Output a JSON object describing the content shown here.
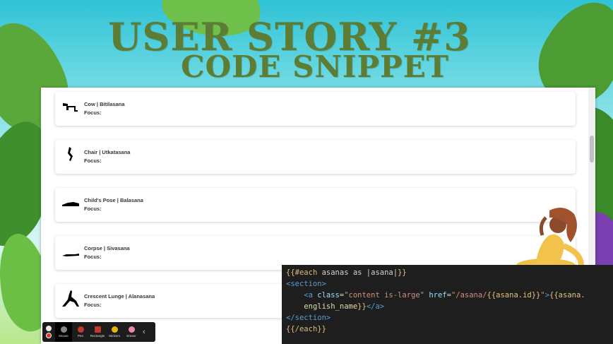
{
  "slide": {
    "title_line1": "USER STORY #3",
    "title_line2": "CODE SNIPPET"
  },
  "poses": [
    {
      "name": "Cow | Bitilasana",
      "focus": "Focus:",
      "icon": "cow-pose-icon"
    },
    {
      "name": "Chair | Utkatasana",
      "focus": "Focus:",
      "icon": "chair-pose-icon"
    },
    {
      "name": "Child's Pose | Balasana",
      "focus": "Focus:",
      "icon": "childs-pose-icon"
    },
    {
      "name": "Corpse | Sivasana",
      "focus": "Focus:",
      "icon": "corpse-pose-icon"
    },
    {
      "name": "Crescent Lunge | Alanasana",
      "focus": "Focus:",
      "icon": "crescent-lunge-icon"
    }
  ],
  "code": {
    "line1_open": "{{",
    "line1_kw": "#each",
    "line1_rest": " asanas as |asana|",
    "line1_close": "}}",
    "line2": "<section>",
    "line3_tag_open": "<a ",
    "line3_attr1": "class",
    "line3_eq1": "=",
    "line3_str1": "\"content is-large\"",
    "line3_attr2": " href",
    "line3_eq2": "=",
    "line3_str2": "\"/asana/",
    "line3_hb": "{{asana.id}}",
    "line3_str3": "\"",
    "line3_tag_close": ">",
    "line3_hb2": "{{asana.",
    "line4_text": "english_name",
    "line4_hb": "}}",
    "line4_close": "</a>",
    "line5": "</section>",
    "line6_open": "{{",
    "line6_kw": "/each",
    "line6_close": "}}"
  },
  "toolbar": {
    "items": [
      {
        "label": "Mouse",
        "color": "#888888"
      },
      {
        "label": "Pen",
        "color": "#c0392b"
      },
      {
        "label": "Rectangle",
        "color": "#c0392b"
      },
      {
        "label": "Stickers",
        "color": "#e6b800"
      },
      {
        "label": "Eraser",
        "color": "#e88aa5"
      }
    ],
    "collapse_icon": "chevron-left-icon"
  },
  "colors": {
    "title": "#5e7d34",
    "code_bg": "#1e1e1e"
  }
}
